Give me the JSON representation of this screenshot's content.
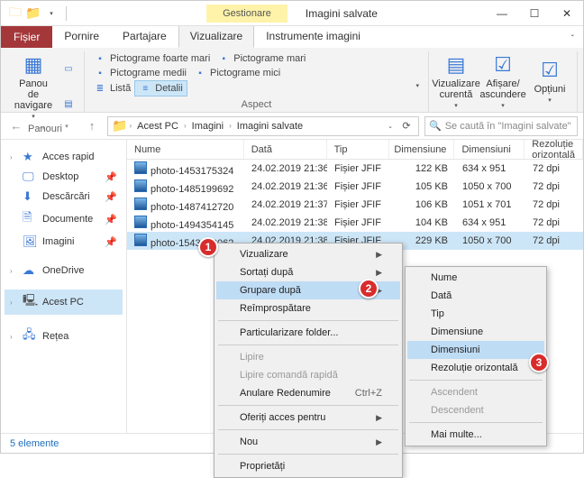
{
  "titlebar": {
    "manage": "Gestionare",
    "wtitle": "Imagini salvate"
  },
  "tabs": {
    "file": "Fișier",
    "t1": "Pornire",
    "t2": "Partajare",
    "t3": "Vizualizare",
    "t4": "Instrumente imagini"
  },
  "ribbon": {
    "panels": "Panouri",
    "nav": "Panou de navigare",
    "aspect": "Aspect",
    "r1": "Pictograme foarte mari",
    "r2": "Pictograme mari",
    "r3": "Pictograme medii",
    "r4": "Pictograme mici",
    "r5": "Listă",
    "r6": "Detalii",
    "vc": "Vizualizare curentă",
    "sa": "Afișare/ ascundere",
    "opt": "Opțiuni"
  },
  "addr": {
    "c1": "Acest PC",
    "c2": "Imagini",
    "c3": "Imagini salvate"
  },
  "search": {
    "ph": "Se caută în \"Imagini salvate\""
  },
  "sidebar": {
    "quick": "Acces rapid",
    "desktop": "Desktop",
    "dl": "Descărcări",
    "docs": "Documente",
    "imgs": "Imagini",
    "od": "OneDrive",
    "pc": "Acest PC",
    "net": "Rețea"
  },
  "cols": {
    "name": "Nume",
    "date": "Dată",
    "type": "Tip",
    "dim": "Dimensiune",
    "dims": "Dimensiuni",
    "res": "Rezoluție orizontală"
  },
  "rows": [
    {
      "name": "photo-1453175324",
      "date": "24.02.2019 21:36",
      "type": "Fișier JFIF",
      "dim": "122 KB",
      "dims": "634 x 951",
      "res": "72 dpi"
    },
    {
      "name": "photo-1485199692",
      "date": "24.02.2019 21:36",
      "type": "Fișier JFIF",
      "dim": "105 KB",
      "dims": "1050 x 700",
      "res": "72 dpi"
    },
    {
      "name": "photo-1487412720",
      "date": "24.02.2019 21:37",
      "type": "Fișier JFIF",
      "dim": "106 KB",
      "dims": "1051 x 701",
      "res": "72 dpi"
    },
    {
      "name": "photo-1494354145",
      "date": "24.02.2019 21:38",
      "type": "Fișier JFIF",
      "dim": "104 KB",
      "dims": "634 x 951",
      "res": "72 dpi"
    },
    {
      "name": "photo-1543909062",
      "date": "24.02.2019 21:38",
      "type": "Fișier JFIF",
      "dim": "229 KB",
      "dims": "1050 x 700",
      "res": "72 dpi"
    }
  ],
  "ctx1": {
    "view": "Vizualizare",
    "sort": "Sortați după",
    "group": "Grupare după",
    "refresh": "Reîmprospătare",
    "custom": "Particularizare folder...",
    "paste": "Lipire",
    "pasteshort": "Lipire comandă rapidă",
    "undo": "Anulare Redenumire",
    "undok": "Ctrl+Z",
    "access": "Oferiți acces pentru",
    "new": "Nou",
    "props": "Proprietăți"
  },
  "ctx2": {
    "name": "Nume",
    "date": "Dată",
    "type": "Tip",
    "dim": "Dimensiune",
    "dims": "Dimensiuni",
    "res": "Rezoluție orizontală",
    "asc": "Ascendent",
    "desc": "Descendent",
    "more": "Mai multe..."
  },
  "status": {
    "text": "5 elemente"
  },
  "callouts": {
    "c1": "1",
    "c2": "2",
    "c3": "3"
  }
}
